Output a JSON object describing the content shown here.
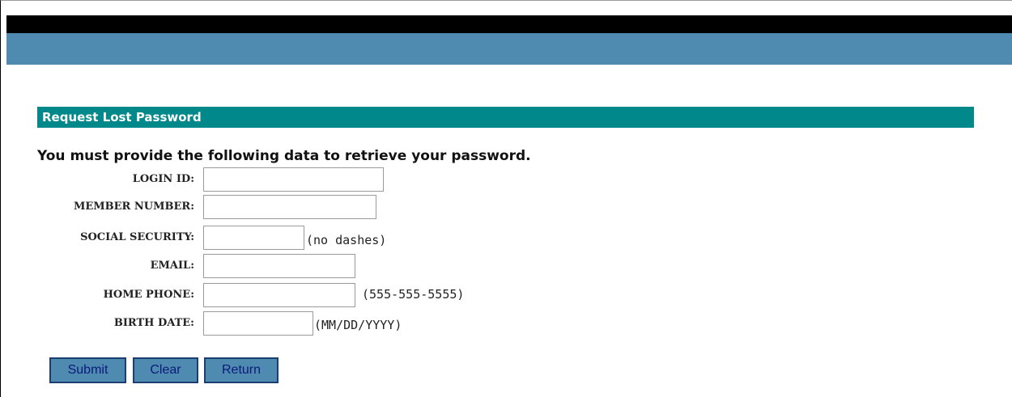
{
  "form": {
    "section_title": "Request Lost Password",
    "instructions": "You must provide the following data to retrieve your password.",
    "fields": [
      {
        "label": "LOGIN ID:",
        "value": "",
        "hint": ""
      },
      {
        "label": "MEMBER NUMBER:",
        "value": "",
        "hint": ""
      },
      {
        "label": "SOCIAL SECURITY:",
        "value": "",
        "hint": "(no dashes)"
      },
      {
        "label": "EMAIL:",
        "value": "",
        "hint": ""
      },
      {
        "label": "HOME PHONE:",
        "value": "",
        "hint": "(555-555-5555)"
      },
      {
        "label": "BIRTH DATE:",
        "value": "",
        "hint": "(MM/DD/YYYY)"
      }
    ]
  },
  "buttons": {
    "submit_label": "Submit",
    "clear_label": "Clear",
    "return_label": "Return"
  },
  "colors": {
    "top_bar": "#000000",
    "nav_bar": "#4f8bb1",
    "section_header": "#00888a",
    "button_bg": "#4f8bb1",
    "button_text": "#0b1a7a"
  }
}
